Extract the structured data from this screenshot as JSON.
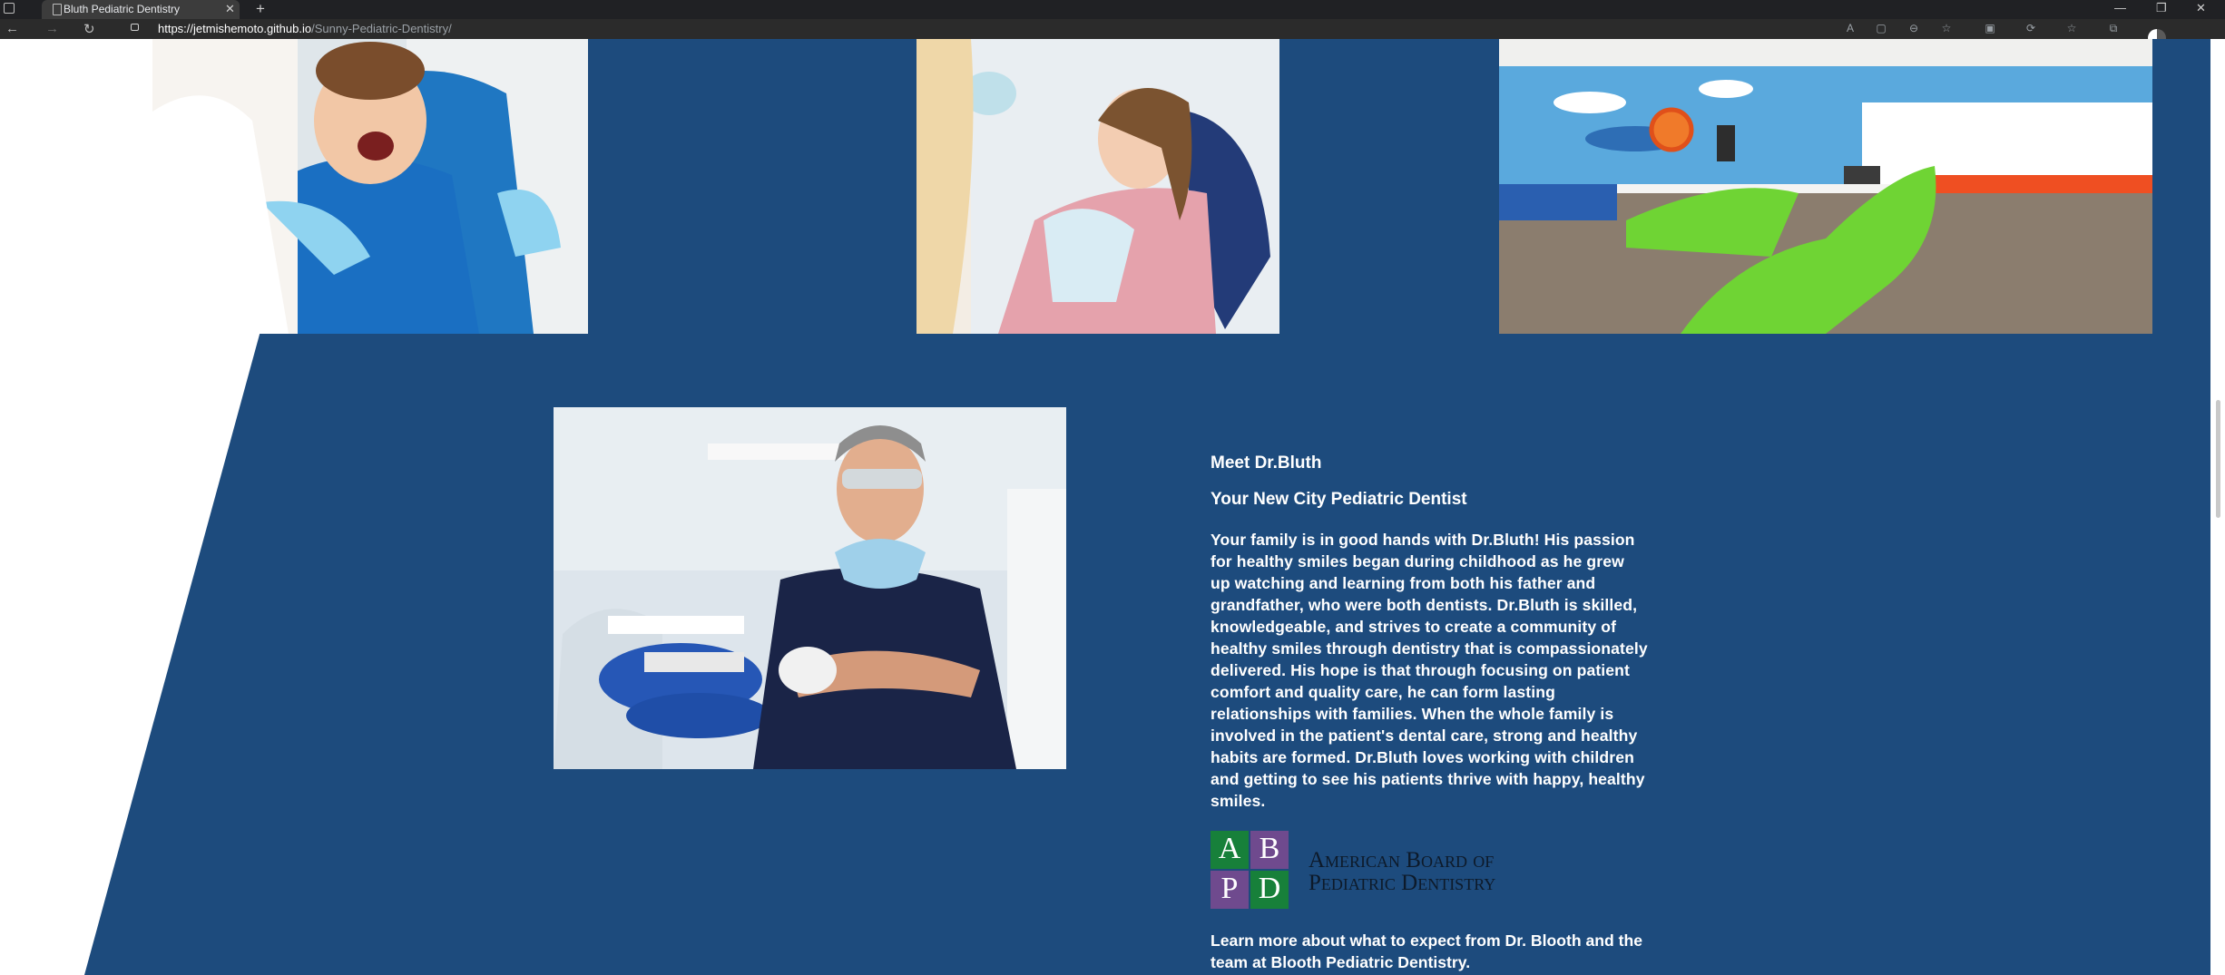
{
  "browser": {
    "tab_title": "Bluth Pediatric Dentistry",
    "url_host": "https://jetmishemoto.github.io",
    "url_path": "/Sunny-Pediatric-Dentistry/"
  },
  "gallery": {
    "photos": [
      "child-patient-open-mouth",
      "girl-in-dental-chair",
      "themed-clinic-room"
    ]
  },
  "about": {
    "doctor_photo": "smiling-dentist-in-clinic",
    "heading": "Meet Dr.Bluth",
    "subheading": "Your New City Pediatric Dentist",
    "bio": "Your family is in good hands with Dr.Bluth! His passion for healthy smiles began during childhood as he grew up watching and learning from both his father and grandfather, who were both dentists. Dr.Bluth is skilled, knowledgeable, and strives to create a community of healthy smiles through dentistry that is compassionately delivered. His hope is that through focusing on patient comfort and quality care, he can form lasting relationships with families. When the whole family is involved in the patient's dental care, strong and healthy habits are formed. Dr.Bluth loves working with children and getting to see his patients thrive with happy, healthy smiles.",
    "abpd_logo": {
      "letters": [
        "A",
        "B",
        "P",
        "D"
      ],
      "line1": "American Board of",
      "line2": "Pediatric Dentistry"
    },
    "learn_more": "Learn more about what to expect from Dr. Blooth and the team at Blooth Pediatric Dentistry."
  },
  "colors": {
    "brand_blue": "#1d4b7d",
    "abpd_green": "#17803a",
    "abpd_purple": "#6f4a8e"
  }
}
